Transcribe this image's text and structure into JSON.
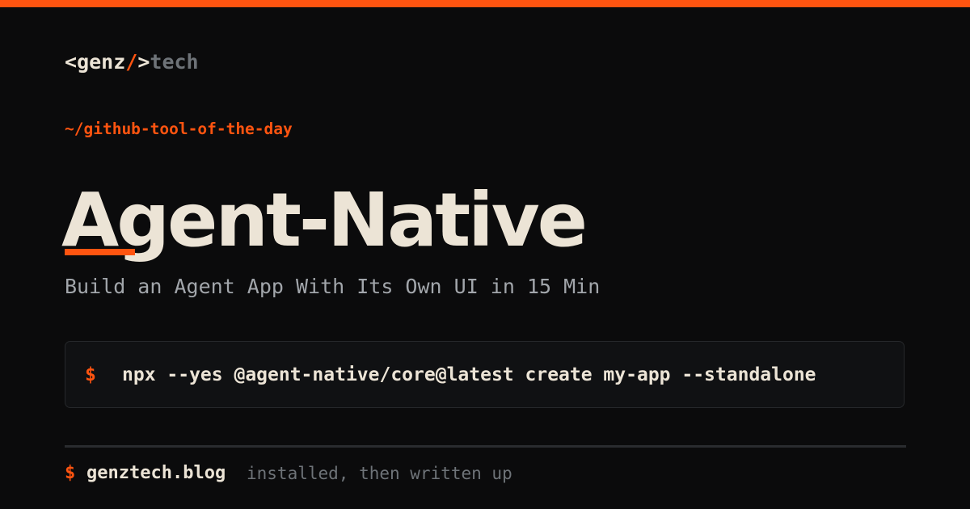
{
  "brand": {
    "lt": "<",
    "genz": "genz",
    "slash": "/",
    "gt": ">",
    "tech": "tech"
  },
  "kicker": "~/github-tool-of-the-day",
  "title": "Agent-Native",
  "subtitle": "Build an Agent App With Its Own UI in 15 Min",
  "command": {
    "prompt": "$",
    "text": "npx --yes @agent-native/core@latest create my-app --standalone"
  },
  "footer": {
    "prompt": "$",
    "domain": "genztech.blog",
    "note": "installed, then written up"
  },
  "colors": {
    "accent": "#ff5410",
    "background": "#0b0b0c",
    "text": "#ece4d6",
    "muted": "#6e7378"
  }
}
